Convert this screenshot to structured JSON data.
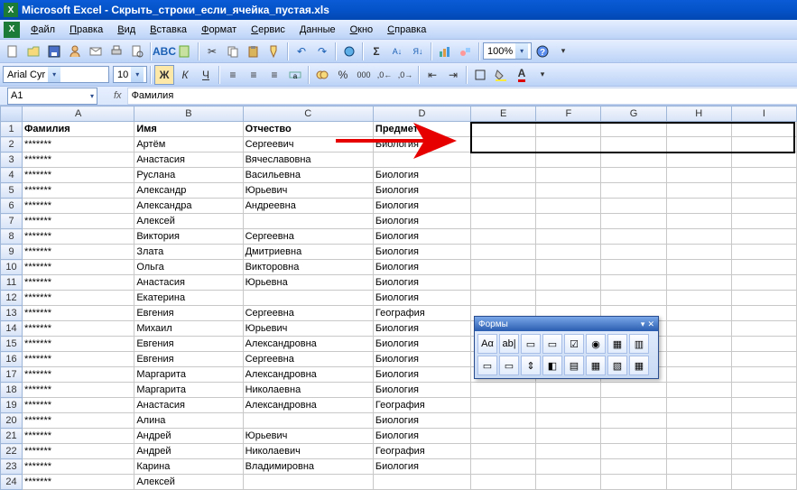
{
  "title": "Microsoft Excel - Скрыть_строки_если_ячейка_пустая.xls",
  "menu": [
    "Файл",
    "Правка",
    "Вид",
    "Вставка",
    "Формат",
    "Сервис",
    "Данные",
    "Окно",
    "Справка"
  ],
  "zoom": "100%",
  "font": {
    "name": "Arial Cyr",
    "size": "10"
  },
  "namebox": "A1",
  "formula": "Фамилия",
  "columns": [
    "A",
    "B",
    "C",
    "D",
    "E",
    "F",
    "G",
    "H",
    "I"
  ],
  "headers": {
    "A": "Фамилия",
    "B": "Имя",
    "C": "Отчество",
    "D": "Предмет"
  },
  "forms": {
    "title": "Формы",
    "labels": [
      "Aα",
      "ab|",
      "▭",
      "▭",
      "☑",
      "◉",
      "▦",
      "▥",
      "▭",
      "▭",
      "⇕",
      "◧",
      "▤",
      "▦",
      "▧",
      "▦"
    ]
  },
  "rows": [
    {
      "n": 1,
      "a": "Фамилия",
      "b": "Имя",
      "c": "Отчество",
      "d": "Предмет",
      "bold": true
    },
    {
      "n": 2,
      "a": "*******",
      "b": "Артём",
      "c": "Сергеевич",
      "d": "Биология"
    },
    {
      "n": 3,
      "a": "*******",
      "b": "Анастасия",
      "c": "Вячеславовна",
      "d": ""
    },
    {
      "n": 4,
      "a": "*******",
      "b": "Руслана",
      "c": "Васильевна",
      "d": "Биология"
    },
    {
      "n": 5,
      "a": "*******",
      "b": "Александр",
      "c": "Юрьевич",
      "d": "Биология"
    },
    {
      "n": 6,
      "a": "*******",
      "b": "Александра",
      "c": "Андреевна",
      "d": "Биология"
    },
    {
      "n": 7,
      "a": "*******",
      "b": "Алексей",
      "c": "",
      "d": "Биология"
    },
    {
      "n": 8,
      "a": "*******",
      "b": "Виктория",
      "c": "Сергеевна",
      "d": "Биология"
    },
    {
      "n": 9,
      "a": "*******",
      "b": "Злата",
      "c": "Дмитриевна",
      "d": "Биология"
    },
    {
      "n": 10,
      "a": "*******",
      "b": "Ольга",
      "c": "Викторовна",
      "d": "Биология"
    },
    {
      "n": 11,
      "a": "*******",
      "b": "Анастасия",
      "c": "Юрьевна",
      "d": "Биология"
    },
    {
      "n": 12,
      "a": "*******",
      "b": "Екатерина",
      "c": "",
      "d": "Биология"
    },
    {
      "n": 13,
      "a": "*******",
      "b": "Евгения",
      "c": "Сергеевна",
      "d": "География"
    },
    {
      "n": 14,
      "a": "*******",
      "b": "Михаил",
      "c": "Юрьевич",
      "d": "Биология"
    },
    {
      "n": 15,
      "a": "*******",
      "b": "Евгения",
      "c": "Александровна",
      "d": "Биология"
    },
    {
      "n": 16,
      "a": "*******",
      "b": "Евгения",
      "c": "Сергеевна",
      "d": "Биология"
    },
    {
      "n": 17,
      "a": "*******",
      "b": "Маргарита",
      "c": "Александровна",
      "d": "Биология"
    },
    {
      "n": 18,
      "a": "*******",
      "b": "Маргарита",
      "c": "Николаевна",
      "d": "Биология"
    },
    {
      "n": 19,
      "a": "*******",
      "b": "Анастасия",
      "c": "Александровна",
      "d": "География"
    },
    {
      "n": 20,
      "a": "*******",
      "b": "Алина",
      "c": "",
      "d": "Биология"
    },
    {
      "n": 21,
      "a": "*******",
      "b": "Андрей",
      "c": "Юрьевич",
      "d": "Биология"
    },
    {
      "n": 22,
      "a": "*******",
      "b": "Андрей",
      "c": "Николаевич",
      "d": "География"
    },
    {
      "n": 23,
      "a": "*******",
      "b": "Карина",
      "c": "Владимировна",
      "d": "Биология"
    },
    {
      "n": 24,
      "a": "*******",
      "b": "Алексей",
      "c": "",
      "d": ""
    }
  ]
}
